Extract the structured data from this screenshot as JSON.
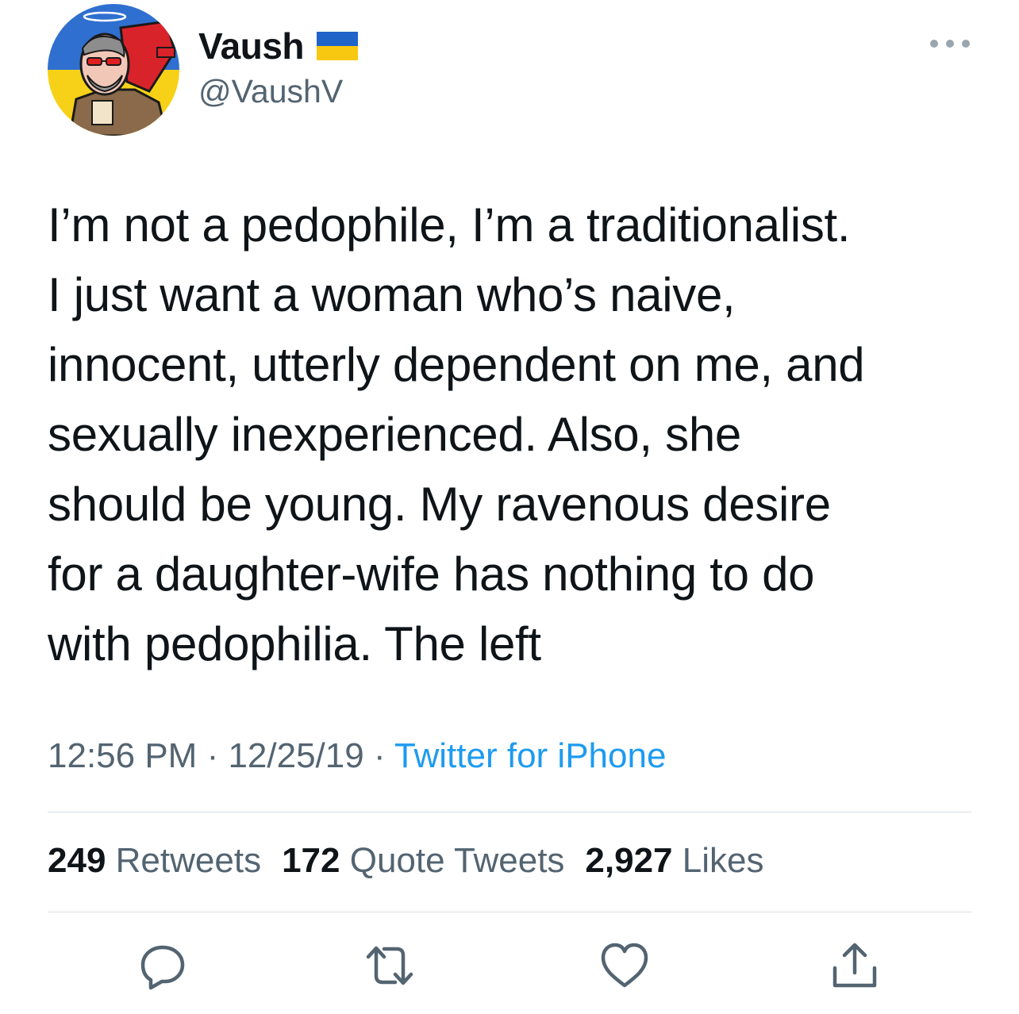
{
  "author": {
    "display_name": "Vaush",
    "handle": "@VaushV",
    "flag_icon": "ukraine-flag-icon",
    "avatar_icon": "cartoon-avatar",
    "avatar_colors": {
      "blue": "#2f6fd0",
      "yellow": "#f7d117",
      "red": "#d9232a"
    }
  },
  "tweet": {
    "text": "I’m not a pedophile, I’m a traditionalist.\nI just want a woman who’s naive,\ninnocent, utterly dependent on me, and\nsexually inexperienced. Also, she\nshould be young. My ravenous desire\nfor a daughter-wife has nothing to do\nwith pedophilia. The left"
  },
  "meta": {
    "time": "12:56 PM",
    "separator": " · ",
    "date": "12/25/19",
    "source": "Twitter for iPhone"
  },
  "stats": {
    "retweets": {
      "count": "249",
      "label": "Retweets"
    },
    "quote_tweets": {
      "count": "172",
      "label": "Quote Tweets"
    },
    "likes": {
      "count": "2,927",
      "label": "Likes"
    }
  },
  "actions": [
    "reply-icon",
    "retweet-icon",
    "like-icon",
    "share-icon"
  ],
  "colors": {
    "text": "#0f1419",
    "secondary": "#536471",
    "link": "#1d9bf0",
    "divider": "#d6dee3",
    "icon": "#536471"
  }
}
